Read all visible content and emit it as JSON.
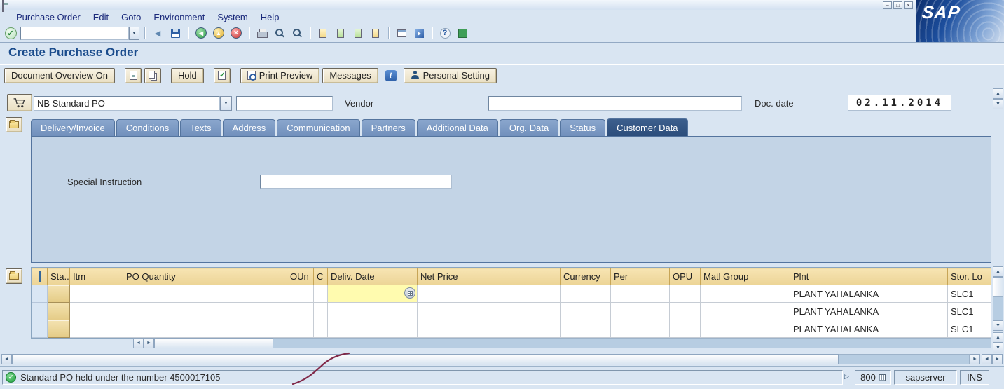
{
  "titlebar": {
    "minimize": "–",
    "maximize": "□",
    "close": "×"
  },
  "logo": {
    "text": "SAP"
  },
  "menubar": {
    "items": [
      "Purchase Order",
      "Edit",
      "Goto",
      "Environment",
      "System",
      "Help"
    ]
  },
  "toolbar": {
    "command_value": ""
  },
  "page": {
    "title": "Create Purchase Order"
  },
  "appbar": {
    "document_overview": "Document Overview On",
    "hold": "Hold",
    "print_preview": "Print Preview",
    "messages": "Messages",
    "personal_setting": "Personal Setting"
  },
  "header": {
    "order_type_value": "NB Standard PO",
    "second_field_value": "",
    "vendor_label": "Vendor",
    "vendor_value": "",
    "doc_date_label": "Doc. date",
    "doc_date_value": "02.11.2014"
  },
  "tabs": [
    "Delivery/Invoice",
    "Conditions",
    "Texts",
    "Address",
    "Communication",
    "Partners",
    "Additional Data",
    "Org. Data",
    "Status",
    "Customer Data"
  ],
  "active_tab": "Customer Data",
  "panel": {
    "special_instruction_label": "Special Instruction",
    "special_instruction_value": ""
  },
  "item_table": {
    "columns": [
      "Sta..",
      "Itm",
      "PO Quantity",
      "OUn",
      "C",
      "Deliv. Date",
      "Net Price",
      "Currency",
      "Per",
      "OPU",
      "Matl Group",
      "Plnt",
      "Stor. Lo"
    ],
    "rows": [
      {
        "sta": "",
        "itm": "",
        "po_quantity": "",
        "oun": "",
        "c": "",
        "deliv_date": "",
        "net_price": "",
        "currency": "",
        "per": "",
        "opu": "",
        "matl_group": "",
        "plnt": "PLANT YAHALANKA",
        "stor_loc": "SLC1"
      },
      {
        "sta": "",
        "itm": "",
        "po_quantity": "",
        "oun": "",
        "c": "",
        "deliv_date": "",
        "net_price": "",
        "currency": "",
        "per": "",
        "opu": "",
        "matl_group": "",
        "plnt": "PLANT YAHALANKA",
        "stor_loc": "SLC1"
      },
      {
        "sta": "",
        "itm": "",
        "po_quantity": "",
        "oun": "",
        "c": "",
        "deliv_date": "",
        "net_price": "",
        "currency": "",
        "per": "",
        "opu": "",
        "matl_group": "",
        "plnt": "PLANT YAHALANKA",
        "stor_loc": "SLC1"
      }
    ]
  },
  "statusbar": {
    "message": "Standard PO held under the number 4500017105",
    "client": "800",
    "server": "sapserver",
    "insert_mode": "INS"
  },
  "icons": {
    "check": "✓",
    "back": "◀",
    "exit": "▲",
    "cancel": "×",
    "up": "▲",
    "down": "▼",
    "left": "◄",
    "right": "►",
    "combo": "▼",
    "expand": "▷"
  }
}
